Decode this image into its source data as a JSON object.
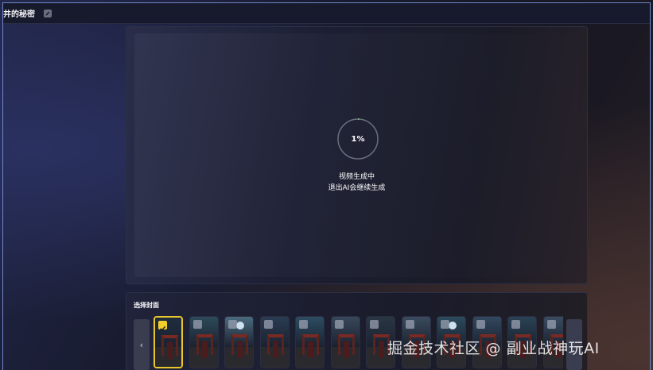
{
  "header": {
    "title": "井的秘密",
    "edit_icon": "edit-icon"
  },
  "player": {
    "progress_label": "1%",
    "progress_fraction": 0.01,
    "status_line1": "视频生成中",
    "status_line2": "退出AI会继续生成",
    "ring_track_color": "#6a6e80",
    "ring_progress_color": "#8fd46b"
  },
  "cover_picker": {
    "label": "选择封面",
    "prev_icon": "chevron-left-icon",
    "next_icon": "chevron-right-icon",
    "prev_symbol": "‹",
    "selected_index": 0,
    "selected_color": "#e8c62c",
    "thumbnails": [
      {
        "sky": "#1f2d3e",
        "moon": false
      },
      {
        "sky": "#2d4a5a",
        "moon": false
      },
      {
        "sky": "#4a6a7e",
        "moon": true
      },
      {
        "sky": "#2a3c52",
        "moon": false
      },
      {
        "sky": "#2d4c62",
        "moon": false
      },
      {
        "sky": "#38475a",
        "moon": false
      },
      {
        "sky": "#2a3644",
        "moon": false
      },
      {
        "sky": "#3a4a5e",
        "moon": false
      },
      {
        "sky": "#2c4a5e",
        "moon": true
      },
      {
        "sky": "#33485e",
        "moon": false
      },
      {
        "sky": "#2a4256",
        "moon": false
      },
      {
        "sky": "#3a4c60",
        "moon": false
      }
    ]
  },
  "watermark": "掘金技术社区 @ 副业战神玩AI"
}
